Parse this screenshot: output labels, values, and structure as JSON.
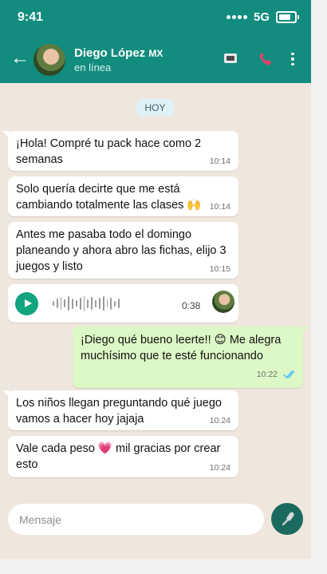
{
  "status_bar": {
    "time": "9:41",
    "network": "5G"
  },
  "header": {
    "back_icon": "arrow-left-icon",
    "contact_name": "Diego López",
    "contact_flag": "MX",
    "contact_status": "en línea"
  },
  "date_separator": "HOY",
  "messages": [
    {
      "direction": "in",
      "text_lines": [
        "¡Hola! Compré tu pack hace como 2",
        "semanas"
      ],
      "time": "10:14"
    },
    {
      "direction": "in",
      "text_lines": [
        "Solo quería decirte que me está",
        "cambiando totalmente las clases 🙌"
      ],
      "time": "10:14"
    },
    {
      "direction": "in",
      "text_lines": [
        "Antes me pasaba todo el domingo",
        "planeando y ahora abro las fichas, elijo 3",
        "juegos y listo"
      ],
      "time": "10:15"
    },
    {
      "direction": "in",
      "type": "audio",
      "duration": "0:38"
    },
    {
      "direction": "out",
      "text_lines": [
        "¡Diego qué bueno leerte!! 😊  Me alegra",
        "muchísimo que te esté funcionando"
      ],
      "time": "10:22",
      "status": "read"
    },
    {
      "direction": "in",
      "text_lines": [
        "Los niños llegan preguntando qué juego",
        "vamos a hacer hoy jajaja"
      ],
      "time": "10:24"
    },
    {
      "direction": "in",
      "text_lines": [
        "Vale cada peso 💗  mil gracias por crear",
        "esto"
      ],
      "time": "10:24"
    }
  ],
  "input": {
    "placeholder": "Mensaje"
  },
  "colors": {
    "header": "#128c7e",
    "chat_background": "#efe7dd",
    "incoming_bubble": "#ffffff",
    "outgoing_bubble": "#dcf8c6",
    "accent": "#12a37f",
    "read_ticks": "#4fc3f7"
  }
}
